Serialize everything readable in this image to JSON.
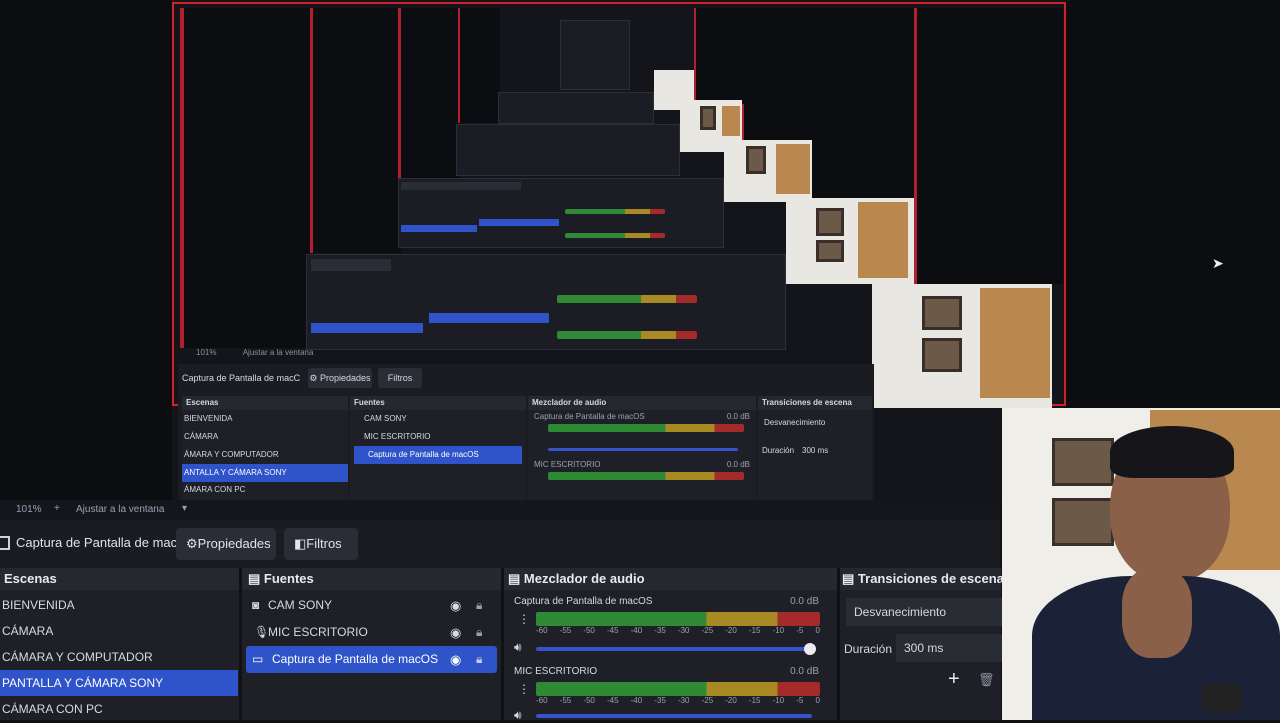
{
  "preview": {
    "nested_source_label": "Captura de Pantalla de macC",
    "nested_props": "Propiedades",
    "nested_filters": "Filtros",
    "nested_scenes_title": "Escenas",
    "nested_sources_title": "Fuentes",
    "nested_mixer_title": "Mezclador de audio",
    "nested_transitions_title": "Transiciones de escena",
    "nested_scenes": [
      "BIENVENIDA",
      "CÁMARA",
      "ÁMARA Y COMPUTADOR",
      "ANTALLA Y CÁMARA SONY",
      "ÁMARA CON PC"
    ],
    "nested_sources": [
      "CAM SONY",
      "MIC ESCRITORIO",
      "Captura de Pantalla de macOS"
    ],
    "nested_mixer_ch1": "Captura de Pantalla de macOS",
    "nested_mixer_ch1_db": "0.0 dB",
    "nested_mixer_ch2": "MIC ESCRITORIO",
    "nested_mixer_ch2_db": "0.0 dB",
    "nested_transition": "Desvanecimiento",
    "nested_duration_label": "Duración",
    "nested_duration_value": "300 ms",
    "nested_zoom": "101%",
    "nested_fit": "Ajustar a la ventana"
  },
  "zoombar": {
    "zoom": "101%",
    "fit_label": "Ajustar a la ventana"
  },
  "toolbar": {
    "source_label": "Captura de Pantalla de macC",
    "properties": "Propiedades",
    "filters": "Filtros"
  },
  "scenes": {
    "title": "Escenas",
    "items": [
      "BIENVENIDA",
      "CÁMARA",
      "CÁMARA Y COMPUTADOR",
      "PANTALLA Y CÁMARA SONY",
      "CÁMARA CON PC"
    ],
    "selected_index": 3
  },
  "sources": {
    "title": "Fuentes",
    "items": [
      {
        "label": "CAM SONY",
        "icon": "camera-icon"
      },
      {
        "label": "MIC ESCRITORIO",
        "icon": "microphone-icon"
      },
      {
        "label": "Captura de Pantalla de macOS",
        "icon": "monitor-icon"
      }
    ],
    "selected_index": 2
  },
  "mixer": {
    "title": "Mezclador de audio",
    "channels": [
      {
        "name": "Captura de Pantalla de macOS",
        "db": "0.0 dB"
      },
      {
        "name": "MIC ESCRITORIO",
        "db": "0.0 dB"
      }
    ],
    "scale": [
      "-60",
      "-55",
      "-50",
      "-45",
      "-40",
      "-35",
      "-30",
      "-25",
      "-20",
      "-15",
      "-10",
      "-5",
      "0"
    ]
  },
  "transitions": {
    "title": "Transiciones de escena",
    "selected": "Desvanecimiento",
    "duration_label": "Duración",
    "duration_value": "300 ms"
  },
  "colors": {
    "selection": "#2f53c8",
    "preview_border": "#d0202a",
    "meter_green": "#2e8a34",
    "meter_yellow": "#a88a25",
    "meter_red": "#a52a2a"
  }
}
